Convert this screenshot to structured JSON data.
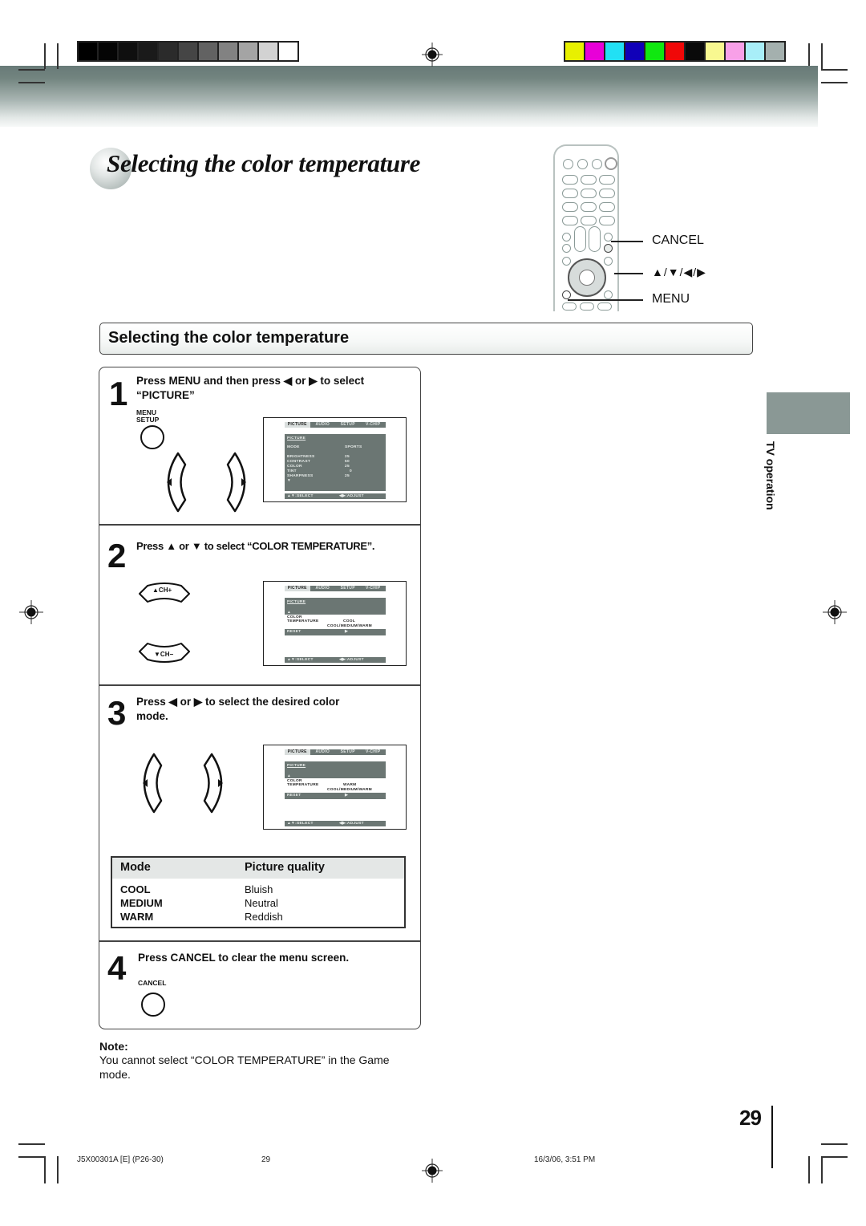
{
  "color_bars": {
    "grayscale": [
      "#000000",
      "#050505",
      "#0f0f0f",
      "#1a1a1a",
      "#2b2b2b",
      "#454545",
      "#626262",
      "#828282",
      "#a4a4a4",
      "#d2d2d2",
      "#ffffff"
    ],
    "colors": [
      "#e8f000",
      "#e800d8",
      "#22e0f4",
      "#1000b8",
      "#10e810",
      "#f00808",
      "#0a0a0a",
      "#f8f890",
      "#f8a0e8",
      "#a8eef8",
      "#a4b0ae"
    ]
  },
  "title": {
    "text": "Selecting the color temperature"
  },
  "remote": {
    "labels": {
      "cancel": "CANCEL",
      "arrows": "▲/▼/◀/▶",
      "menu": "MENU"
    }
  },
  "section": {
    "heading": "Selecting the color temperature"
  },
  "steps": [
    {
      "number": "1",
      "text_line1": "Press MENU and then press ◀ or ▶ to select",
      "text_line2": "“PICTURE”",
      "button_label_1": "MENU",
      "button_label_2": "SETUP",
      "osd": {
        "tabs": [
          "PICTURE",
          "AUDIO",
          "SETUP",
          "V-CHIP"
        ],
        "panel_title": "PICTURE",
        "rows": [
          {
            "label": "MODE",
            "value": "SPORTS"
          },
          {
            "label": "BRIGHTNESS",
            "value": "25"
          },
          {
            "label": "CONTRAST",
            "value": "50"
          },
          {
            "label": "COLOR",
            "value": "25"
          },
          {
            "label": "TINT",
            "value": "0"
          },
          {
            "label": "SHARPNESS",
            "value": "25"
          }
        ],
        "more_indicator": "▼",
        "footer_select": "▲▼:SELECT",
        "footer_adjust": "◀▶:ADJUST"
      }
    },
    {
      "number": "2",
      "text_line1": "Press ▲ or ▼ to select “COLOR TEMPERATURE”.",
      "ch_up_label": "▲CH+",
      "ch_down_label": "▼CH−",
      "osd": {
        "tabs": [
          "PICTURE",
          "AUDIO",
          "SETUP",
          "V-CHIP"
        ],
        "panel_title": "PICTURE",
        "up_indicator": "▲",
        "item_line1": "COLOR",
        "item_line2": "TEMPERATURE",
        "item_value": "COOL",
        "item_options": "COOL/MEDIUM/WARM",
        "reset_label": "RESET",
        "reset_arrow": "▶",
        "footer_select": "▲▼:SELECT",
        "footer_adjust": "◀▶:ADJUST"
      }
    },
    {
      "number": "3",
      "text_line1": "Press ◀ or ▶ to select the desired color",
      "text_line2": "mode.",
      "osd": {
        "tabs": [
          "PICTURE",
          "AUDIO",
          "SETUP",
          "V-CHIP"
        ],
        "panel_title": "PICTURE",
        "up_indicator": "▲",
        "item_line1": "COLOR",
        "item_line2": "TEMPERATURE",
        "item_value": "WARM",
        "item_options": "COOL/MEDIUM/WARM",
        "reset_label": "RESET",
        "reset_arrow": "▶",
        "footer_select": "▲▼:SELECT",
        "footer_adjust": "◀▶:ADJUST"
      }
    },
    {
      "number": "4",
      "text_line1": "Press CANCEL to clear the menu screen.",
      "button_label": "CANCEL"
    }
  ],
  "mode_table": {
    "headers": [
      "Mode",
      "Picture quality"
    ],
    "rows": [
      {
        "mode": "COOL",
        "quality": "Bluish"
      },
      {
        "mode": "MEDIUM",
        "quality": "Neutral"
      },
      {
        "mode": "WARM",
        "quality": "Reddish"
      }
    ]
  },
  "note": {
    "title": "Note:",
    "text": "You cannot select “COLOR TEMPERATURE” in the Game mode."
  },
  "side_tab": {
    "label": "TV operation",
    "color": "#8a9895"
  },
  "page_number": "29",
  "footer": {
    "doc_code": "J5X00301A [E] (P26-30)",
    "page": "29",
    "timestamp": "16/3/06, 3:51 PM"
  }
}
